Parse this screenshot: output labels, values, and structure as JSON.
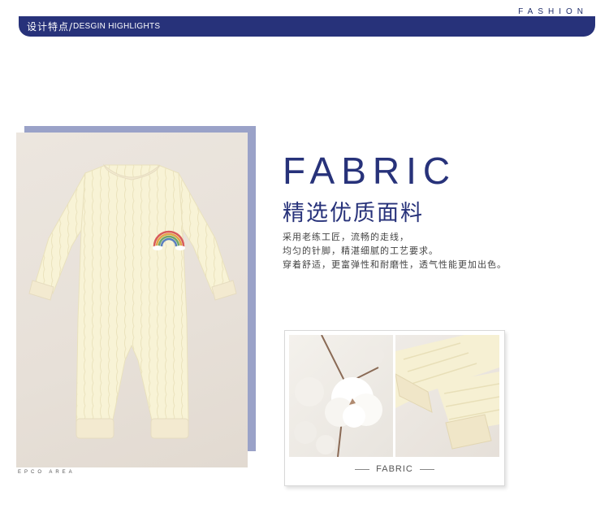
{
  "header": {
    "fashion": "FASHION",
    "title_cn": "设计特点/",
    "title_en": "DESGIN HIGHLIGHTS"
  },
  "photo": {
    "caption": "EPCO AREA"
  },
  "fabric": {
    "title": "FABRIC",
    "subtitle": "精选优质面料",
    "desc_lines": [
      "采用老练工匠，流畅的走线，",
      "均匀的针脚，精湛细腻的工艺要求。",
      "穿着舒适，更富弹性和耐磨性，透气性能更加出色。"
    ]
  },
  "card": {
    "label": "FABRIC"
  },
  "colors": {
    "brand": "#27327a",
    "panel": "#9aa2c8",
    "romper": "#f8f3d6"
  }
}
